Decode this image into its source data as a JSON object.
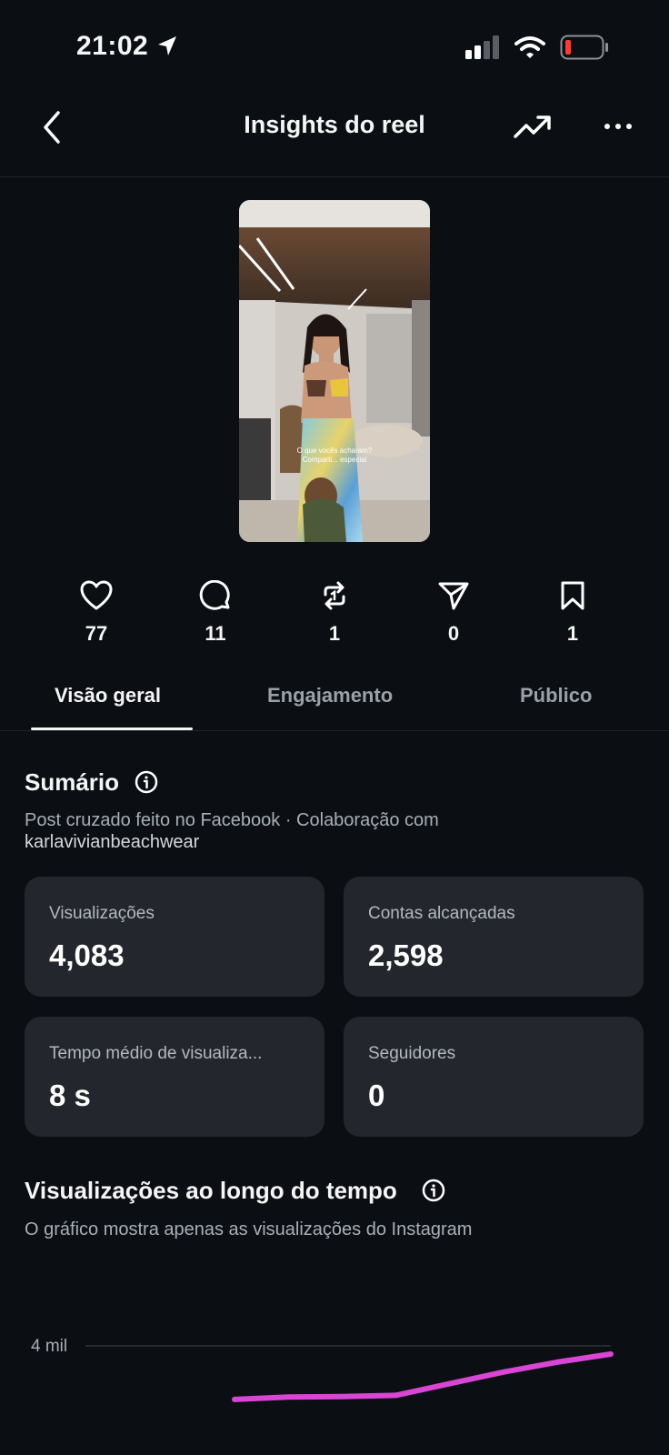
{
  "status_bar": {
    "time": "21:02"
  },
  "header": {
    "title": "Insights do reel"
  },
  "stats": [
    {
      "icon": "heart-icon",
      "value": "77"
    },
    {
      "icon": "comment-icon",
      "value": "11"
    },
    {
      "icon": "repost-icon",
      "value": "1"
    },
    {
      "icon": "share-icon",
      "value": "0"
    },
    {
      "icon": "bookmark-icon",
      "value": "1"
    }
  ],
  "tabs": [
    {
      "label": "Visão geral"
    },
    {
      "label": "Engajamento"
    },
    {
      "label": "Público"
    }
  ],
  "summary": {
    "title": "Sumário",
    "description": "Post cruzado feito no Facebook · Colaboração com",
    "collaborator": "karlavivianbeachwear",
    "cards": [
      {
        "label": "Visualizações",
        "value": "4,083"
      },
      {
        "label": "Contas alcançadas",
        "value": "2,598"
      },
      {
        "label": "Tempo médio de visualiza...",
        "value": "8 s"
      },
      {
        "label": "Seguidores",
        "value": "0"
      }
    ]
  },
  "views_over_time": {
    "title": "Visualizações ao longo do tempo",
    "subtitle": "O gráfico mostra apenas as visualizações do Instagram"
  },
  "colors": {
    "accent_line": "#d946d3",
    "background": "#0b0e13",
    "card": "#23262d"
  },
  "chart_data": {
    "type": "line",
    "y_ticks": [
      "4 mil"
    ],
    "series": [
      {
        "values": [
          3080,
          3120,
          3130,
          3150,
          3350,
          3550,
          3720,
          3860
        ]
      }
    ],
    "ylim": [
      0,
      4000
    ]
  }
}
